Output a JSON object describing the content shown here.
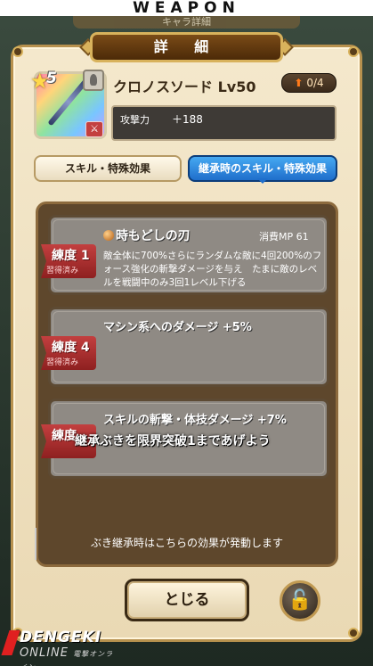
{
  "banner": {
    "text": "WEAPON"
  },
  "top_strip": {
    "text": "キャラ詳細"
  },
  "panel": {
    "title": "詳 細"
  },
  "weapon": {
    "rarity": "5",
    "name": "クロノスソード Lv50",
    "level_badge": "0/4",
    "stat_label": "攻撃力",
    "stat_value": "＋188",
    "type_icon": "crossed-sword-icon"
  },
  "tabs": {
    "left": "スキル・特殊効果",
    "right": "継承時のスキル・特殊効果",
    "active": "right"
  },
  "skills": [
    {
      "tag": "練度 1",
      "tag_sub": "習得済み",
      "title": "時もどしの刃",
      "mp": "消費MP 61",
      "desc": "敵全体に700%さらにランダムな敵に4回200%のフォース強化の斬撃ダメージを与え　たまに敵のレベルを戦闘中のみ3回1レベル下げる"
    },
    {
      "tag": "練度 4",
      "tag_sub": "習得済み",
      "title": "マシン系へのダメージ +5%",
      "mp": "",
      "desc": ""
    },
    {
      "tag": "練度",
      "tag_sub": "",
      "title": "スキルの斬撃・体技ダメージ +7%",
      "mp": "",
      "desc": ""
    }
  ],
  "overlay_notice": "継承ぶきを限界突破1まであげよう",
  "footer_note": "ぶき継承時はこちらの効果が発動します",
  "buttons": {
    "close": "とじる",
    "lock_icon": "padlock-icon"
  },
  "watermark": {
    "brand": "DENGEKI",
    "sub": "ONLINE",
    "small": "電撃オンライン"
  },
  "colors": {
    "panel_bg": "#f4e8cc",
    "tab_active": "#1f6ecb",
    "skill_tag": "#c33f3f",
    "level_arrow": "#ff7a1a"
  }
}
